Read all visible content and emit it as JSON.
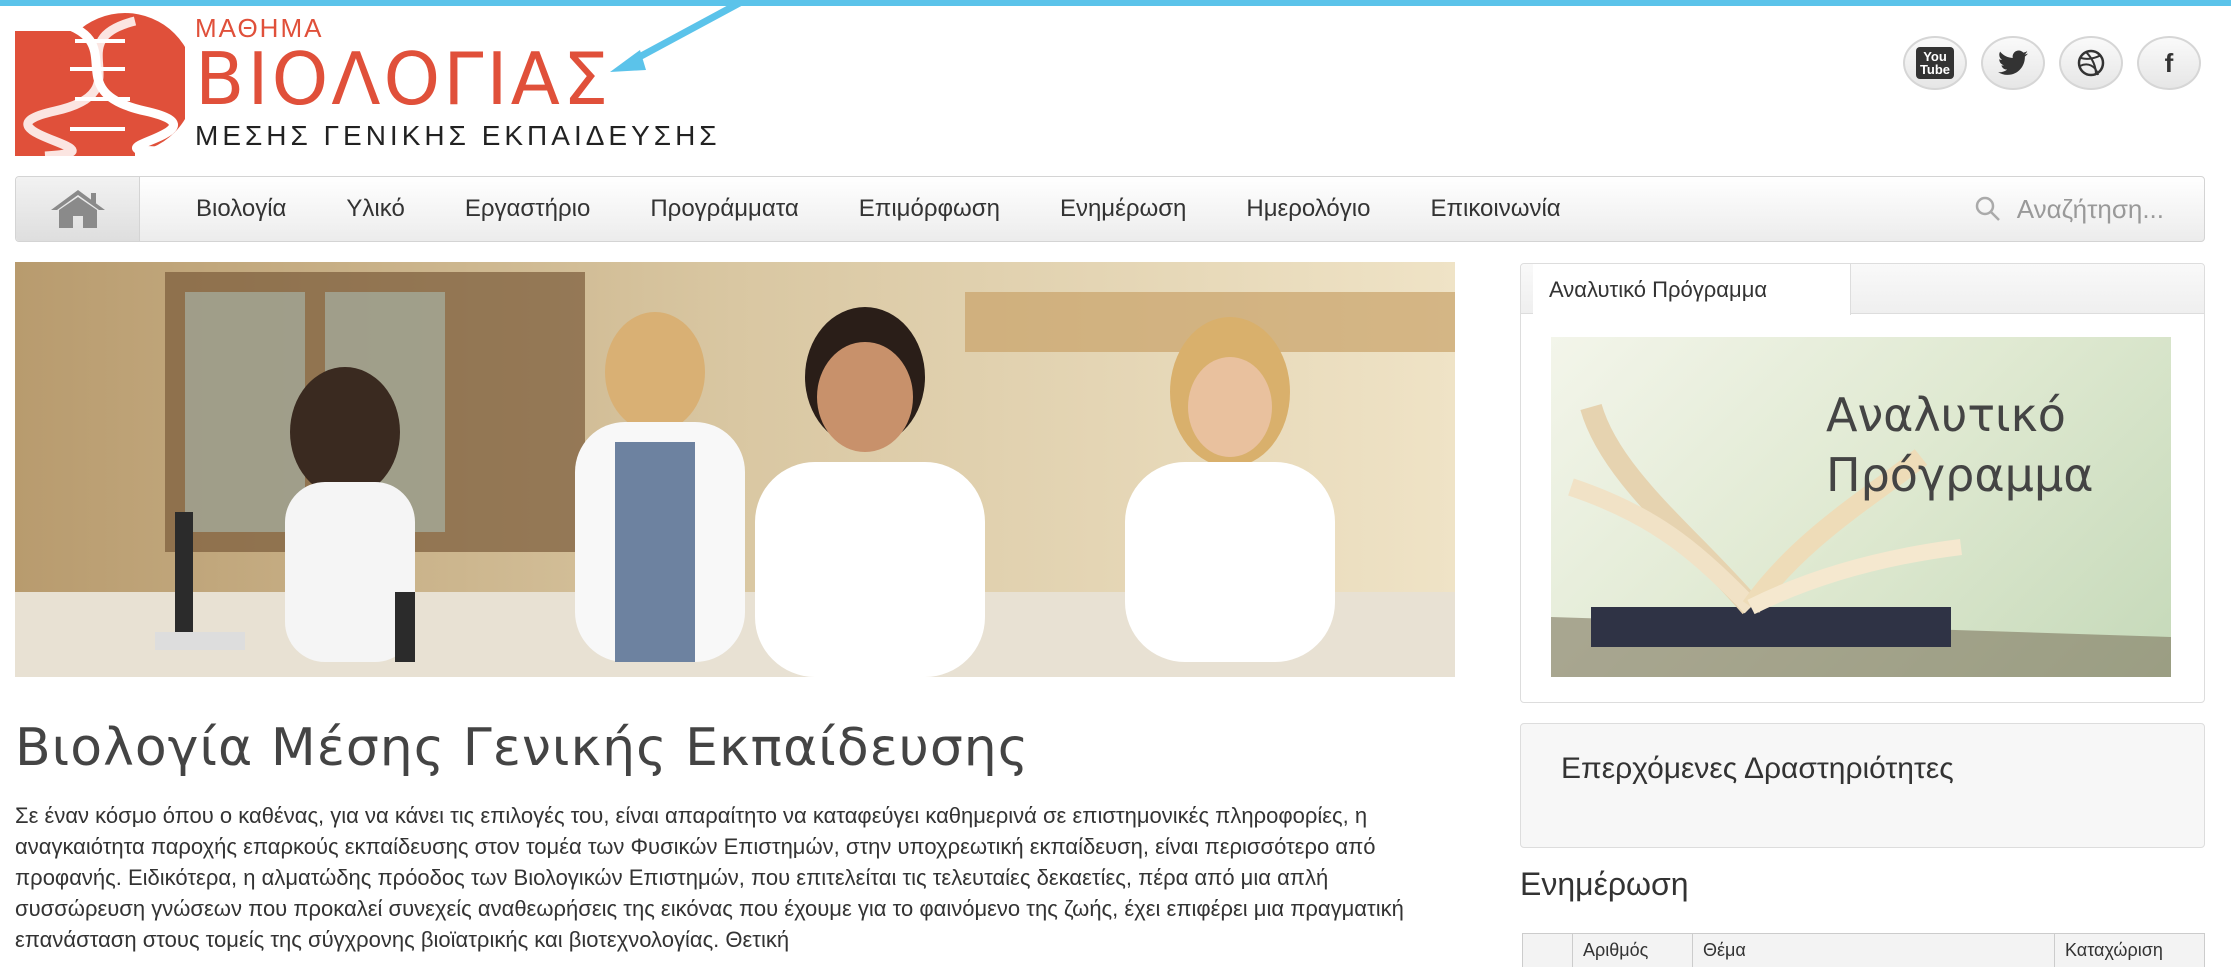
{
  "logo": {
    "small": "ΜΑΘΗΜΑ",
    "big": "ΒΙΟΛΟΓΙΑΣ",
    "sub": "ΜΕΣΗΣ ΓΕΝΙΚΗΣ ΕΚΠΑΙΔΕΥΣΗΣ"
  },
  "social": [
    {
      "name": "youtube",
      "glyph_top": "You",
      "glyph_bottom": "Tube"
    },
    {
      "name": "twitter",
      "glyph": "🐦"
    },
    {
      "name": "dribbble",
      "glyph": "◎"
    },
    {
      "name": "facebook",
      "glyph": "f"
    }
  ],
  "nav": {
    "items": [
      "Βιολογία",
      "Υλικό",
      "Εργαστήριο",
      "Προγράμματα",
      "Επιμόρφωση",
      "Ενημέρωση",
      "Ημερολόγιο",
      "Επικοινωνία"
    ],
    "search_placeholder": "Αναζήτηση..."
  },
  "main": {
    "title": "Βιολογία Μέσης Γενικής Εκπαίδευσης",
    "intro": "Σε έναν κόσμο όπου ο καθένας, για να κάνει τις επιλογές του, είναι απαραίτητο να καταφεύγει καθημερινά σε επιστημονικές πληροφορίες, η αναγκαιότητα παροχής επαρκούς εκπαίδευσης στον τομέα των Φυσικών Επιστημών, στην υποχρεωτική εκπαίδευση, είναι περισσότερο από προφανής. Ειδικότερα, η αλματώδης πρόοδος των Βιολογικών Επιστημών, που επιτελείται τις τελευταίες δεκαετίες, πέρα από μια απλή συσσώρευση γνώσεων που προκαλεί συνεχείς αναθεωρήσεις της εικόνας που έχουμε για το φαινόμενο της ζωής, έχει επιφέρει μια πραγματική επανάσταση στους τομείς της σύγχρονης βιοϊατρικής και βιοτεχνολογίας. Θετική"
  },
  "sidebar": {
    "program_tab": "Αναλυτικό Πρόγραμμα",
    "program_image_line1": "Αναλυτικό",
    "program_image_line2": "Πρόγραμμα",
    "upcoming_title": "Επερχόμενες Δραστηριότητες",
    "news_title": "Ενημέρωση",
    "news_columns": [
      "",
      "Αριθμός",
      "Θέμα",
      "Καταχώριση"
    ]
  },
  "colors": {
    "logo_red": "#e0503a",
    "accent_blue": "#5bc3ea"
  }
}
